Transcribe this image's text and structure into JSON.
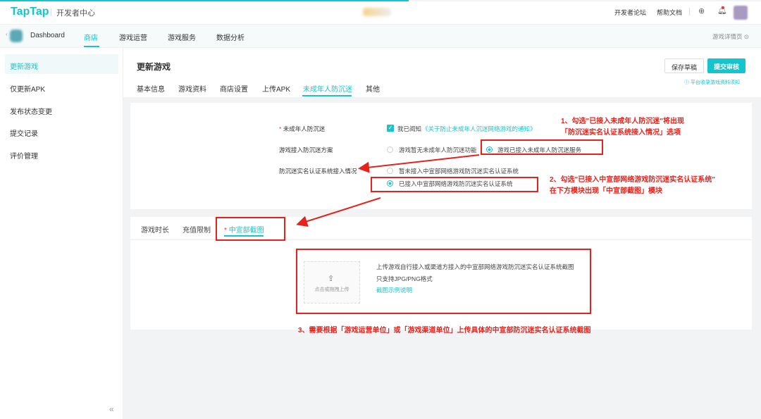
{
  "topbar": {
    "logo": "TapTap",
    "subtitle": "开发者中心",
    "links": [
      "开发者论坛",
      "帮助文档"
    ]
  },
  "nav": {
    "items": [
      "Dashboard",
      "商店",
      "游戏运营",
      "游戏服务",
      "数据分析"
    ],
    "right": "游戏详情页"
  },
  "sidebar": {
    "items": [
      "更新游戏",
      "仅更新APK",
      "发布状态变更",
      "提交记录",
      "评价管理"
    ]
  },
  "header": {
    "title": "更新游戏",
    "tabs": [
      "基本信息",
      "游戏资料",
      "商店设置",
      "上传APK",
      "未成年人防沉迷",
      "其他"
    ],
    "save": "保存草稿",
    "submit": "提交审核",
    "notice": "平台收录游戏资料须知"
  },
  "form": {
    "row1": {
      "label": "未成年人防沉迷",
      "required": "*",
      "check_text": "我已阅知",
      "link": "《关于防止未成年人沉迷网络游戏的通知》"
    },
    "row2": {
      "label": "游戏接入防沉迷方案",
      "opt1": "游戏暂无未成年人防沉迷功能",
      "opt2": "游戏已接入未成年人防沉迷服务"
    },
    "row3": {
      "label": "防沉迷实名认证系统接入情况",
      "opt1": "暂未接入中宣部网络游戏防沉迷实名认证系统",
      "opt2": "已接入中宣部网络游戏防沉迷实名认证系统"
    }
  },
  "subtabs": {
    "items": [
      "游戏时长",
      "充值限制",
      "中宣部截图"
    ],
    "required": "*"
  },
  "upload": {
    "hint": "点击或拖拽上传",
    "desc": "上传游戏自行接入或渠道方接入的中宣部网络游戏防沉迷实名认证系统截图",
    "format": "只支持JPG/PNG格式",
    "example": "截图示例说明"
  },
  "annotations": {
    "a1_line1": "1、勾选\"已接入未成年人防沉迷\"将出现",
    "a1_line2": "「防沉迷实名认证系统接入情况」选项",
    "a2_line1": "2、勾选\"已接入中宣部网络游戏防沉迷实名认证系统\"",
    "a2_line2": "在下方模块出现「中宣部截图」模块",
    "a3": "3、需要根据「游戏运营单位」或「游戏渠道单位」上传具体的中宣部防沉迷实名认证系统截图"
  },
  "sidebar_collapse": "«"
}
